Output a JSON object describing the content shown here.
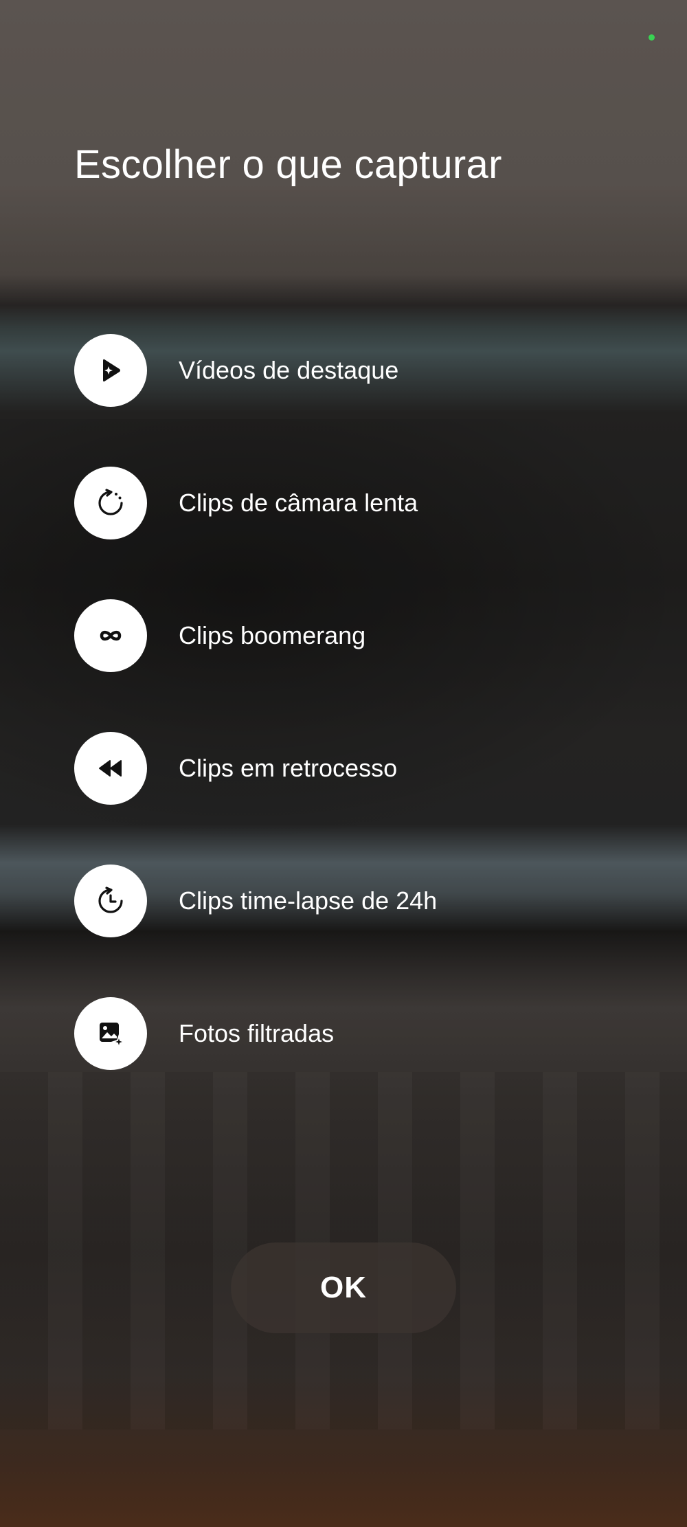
{
  "dialog": {
    "title": "Escolher o que capturar",
    "options": [
      {
        "label": "Vídeos de destaque",
        "icon": "highlight-video-icon"
      },
      {
        "label": "Clips de câmara lenta",
        "icon": "slow-motion-icon"
      },
      {
        "label": "Clips boomerang",
        "icon": "infinity-icon"
      },
      {
        "label": "Clips em retrocesso",
        "icon": "rewind-icon"
      },
      {
        "label": "Clips time-lapse de 24h",
        "icon": "timelapse-clock-icon"
      },
      {
        "label": "Fotos filtradas",
        "icon": "filtered-photo-icon"
      }
    ],
    "ok_label": "OK"
  },
  "colors": {
    "icon_background": "#ffffff",
    "icon_glyph": "#111111",
    "text": "#ffffff",
    "ok_button_bg": "#3c3430",
    "privacy_indicator": "#39d353"
  }
}
